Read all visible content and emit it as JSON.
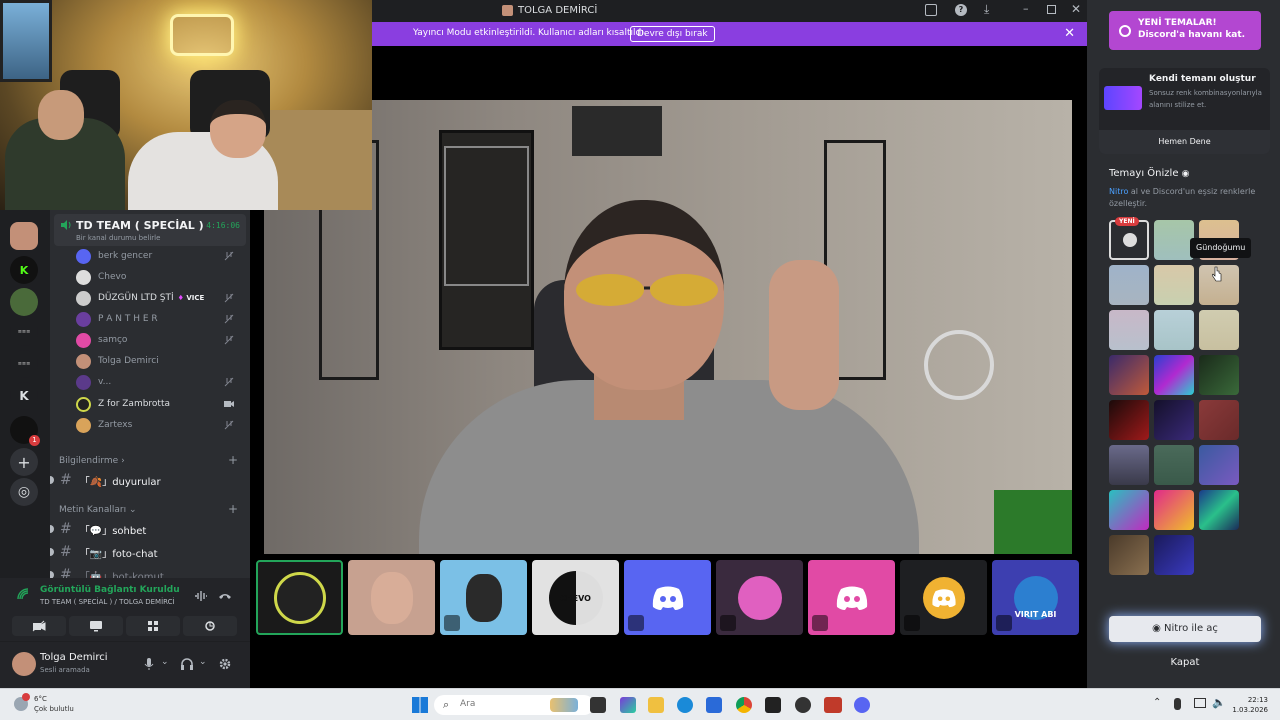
{
  "window": {
    "title": "TOLGA DEMİRCİ"
  },
  "streamer_banner": {
    "text": "Yayıncı Modu etkinleştirildi. Kullanıcı adları kısaltıldı.",
    "button": "Devre dışı bırak"
  },
  "voice_channel": {
    "name": "TD TEAM ( SPECİAL )",
    "timer": "4:16:06",
    "status_hint": "Bir kanal durumu belirle",
    "members": [
      {
        "name": "berk gencer"
      },
      {
        "name": "Chevo"
      },
      {
        "name": "DÜZGÜN LTD ŞTİ",
        "tag": "VICE"
      },
      {
        "name": "P A N T H E R"
      },
      {
        "name": "samço"
      },
      {
        "name": "Tolga Demirci"
      },
      {
        "name": "v..."
      },
      {
        "name": "Z for Zambrotta"
      },
      {
        "name": "Zartexs"
      }
    ]
  },
  "categories": {
    "info": "Bilgilendirme",
    "text": "Metin Kanalları"
  },
  "channels": {
    "announcements": "duyurular",
    "chat": "sohbet",
    "photo": "foto-chat",
    "bot": "bot-komut"
  },
  "voice_connection": {
    "status": "Görüntülü Bağlantı Kuruldu",
    "path": "TD TEAM ( SPECİAL ) / TOLGA DEMİRCİ"
  },
  "user": {
    "name": "Tolga Demirci",
    "status": "Sesli aramada"
  },
  "tiles": [
    {
      "label": ""
    },
    {
      "label": ""
    },
    {
      "label": ""
    },
    {
      "label": "CHEVO"
    },
    {
      "label": ""
    },
    {
      "label": ""
    },
    {
      "label": ""
    },
    {
      "label": ""
    },
    {
      "label": "VIRIT ABI"
    }
  ],
  "theme_panel": {
    "promo": "YENİ TEMALAR!\nDiscord'a havanı kat.",
    "promo_line1": "YENİ TEMALAR!",
    "promo_line2": "Discord'a havanı kat.",
    "create_title": "Kendi temanı oluştur",
    "create_desc": "Sonsuz renk kombinasyonlarıyla alanını stilize et.",
    "try_button": "Hemen Dene",
    "preview_title": "Temayı Önizle",
    "preview_desc_nitro": "Nitro",
    "preview_desc": " al ve Discord'un eşsiz renklerle özelleştir.",
    "new_badge": "YENİ",
    "tooltip": "Gündoğumu",
    "open_button": "Nitro ile aç",
    "close_button": "Kapat"
  },
  "taskbar": {
    "temp": "6°C",
    "weather": "Çok bulutlu",
    "search": "Ara",
    "time": "22:13",
    "date": "1.03.2026"
  },
  "colors": {
    "accent": "#8a3ee0",
    "online": "#23a55a",
    "promo": "#b347d1"
  }
}
